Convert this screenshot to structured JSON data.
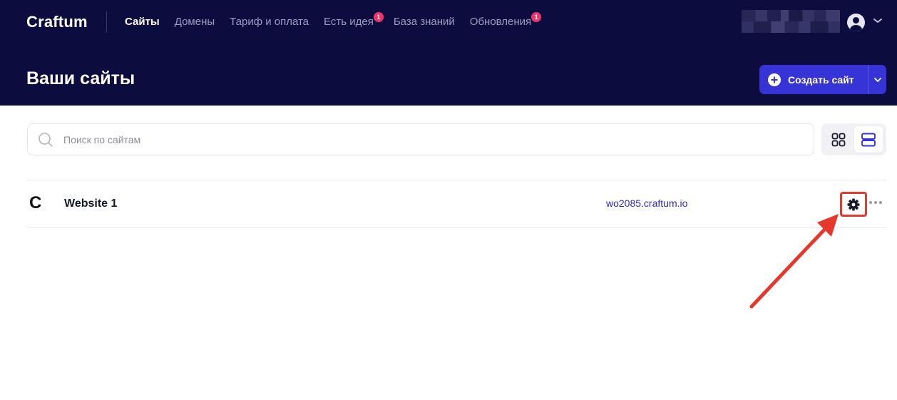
{
  "brand": {
    "name": "Craftum"
  },
  "nav": {
    "items": [
      {
        "label": "Сайты",
        "active": true
      },
      {
        "label": "Домены"
      },
      {
        "label": "Тариф и оплата"
      },
      {
        "label": "Есть идея",
        "badge": "1"
      },
      {
        "label": "База знаний"
      },
      {
        "label": "Обновления",
        "badge": "1"
      }
    ]
  },
  "header": {
    "title": "Ваши сайты",
    "create_button": "Создать сайт"
  },
  "search": {
    "placeholder": "Поиск по сайтам"
  },
  "sites": [
    {
      "logo": "C",
      "name": "Website 1",
      "url": "wo2085.craftum.io"
    }
  ],
  "colors": {
    "header_bg": "#0d0c3f",
    "accent": "#3634d6",
    "badge": "#f2336b",
    "link": "#2a28c9",
    "highlight": "#e23a2e"
  },
  "icons": {
    "user": "user-avatar-icon",
    "dropdown": "chevron-down-icon",
    "create": "plus-circle-icon",
    "search": "search-icon",
    "grid_view": "grid-view-icon",
    "list_view": "list-view-icon",
    "settings": "gear-icon",
    "more": "more-horizontal-icon"
  }
}
